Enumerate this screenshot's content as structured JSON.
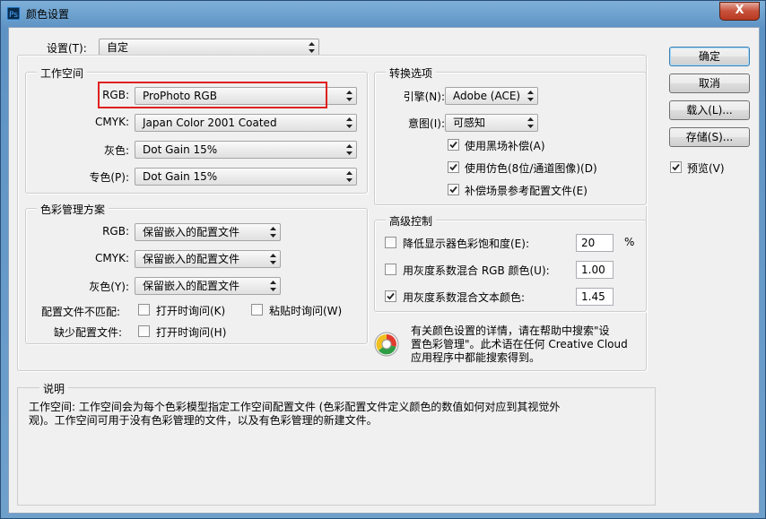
{
  "window": {
    "title": "颜色设置",
    "close_label": "X"
  },
  "settings": {
    "label": "设置(T):",
    "value": "自定"
  },
  "workspace": {
    "title": "工作空间",
    "rgb_label": "RGB:",
    "rgb_value": "ProPhoto RGB",
    "cmyk_label": "CMYK:",
    "cmyk_value": "Japan Color 2001 Coated",
    "gray_label": "灰色:",
    "gray_value": "Dot Gain 15%",
    "spot_label": "专色(P):",
    "spot_value": "Dot Gain 15%"
  },
  "policies": {
    "title": "色彩管理方案",
    "rgb_label": "RGB:",
    "rgb_value": "保留嵌入的配置文件",
    "cmyk_label": "CMYK:",
    "cmyk_value": "保留嵌入的配置文件",
    "gray_label": "灰色(Y):",
    "gray_value": "保留嵌入的配置文件",
    "mismatch_label": "配置文件不匹配:",
    "ask_open": "打开时询问(K)",
    "ask_paste": "粘贴时询问(W)",
    "missing_label": "缺少配置文件:",
    "ask_open_missing": "打开时询问(H)"
  },
  "conversion": {
    "title": "转换选项",
    "engine_label": "引擎(N):",
    "engine_value": "Adobe (ACE)",
    "intent_label": "意图(I):",
    "intent_value": "可感知",
    "bpc": "使用黑场补偿(A)",
    "dither": "使用仿色(8位/通道图像)(D)",
    "compensate": "补偿场景参考配置文件(E)"
  },
  "advanced": {
    "title": "高级控制",
    "desaturate": "降低显示器色彩饱和度(E):",
    "desaturate_value": "20",
    "percent": "%",
    "blend_rgb": "用灰度系数混合 RGB 颜色(U):",
    "blend_rgb_value": "1.00",
    "blend_text": "用灰度系数混合文本颜色:",
    "blend_text_value": "1.45"
  },
  "info": {
    "line1": "有关颜色设置的详情，请在帮助中搜索\"设",
    "line2": "置色彩管理\"。此术语在任何 Creative Cloud",
    "line3": "应用程序中都能搜索得到。"
  },
  "description": {
    "title": "说明",
    "line1": "工作空间: 工作空间会为每个色彩模型指定工作空间配置文件 (色彩配置文件定义颜色的数值如何对应到其视觉外",
    "line2": "观)。工作空间可用于没有色彩管理的文件，以及有色彩管理的新建文件。"
  },
  "buttons": {
    "ok": "确定",
    "cancel": "取消",
    "load": "载入(L)...",
    "save": "存储(S)...",
    "preview": "预览(V)"
  },
  "colors": {
    "highlight": "#e02020",
    "titlebar": "#6fa0cc"
  }
}
